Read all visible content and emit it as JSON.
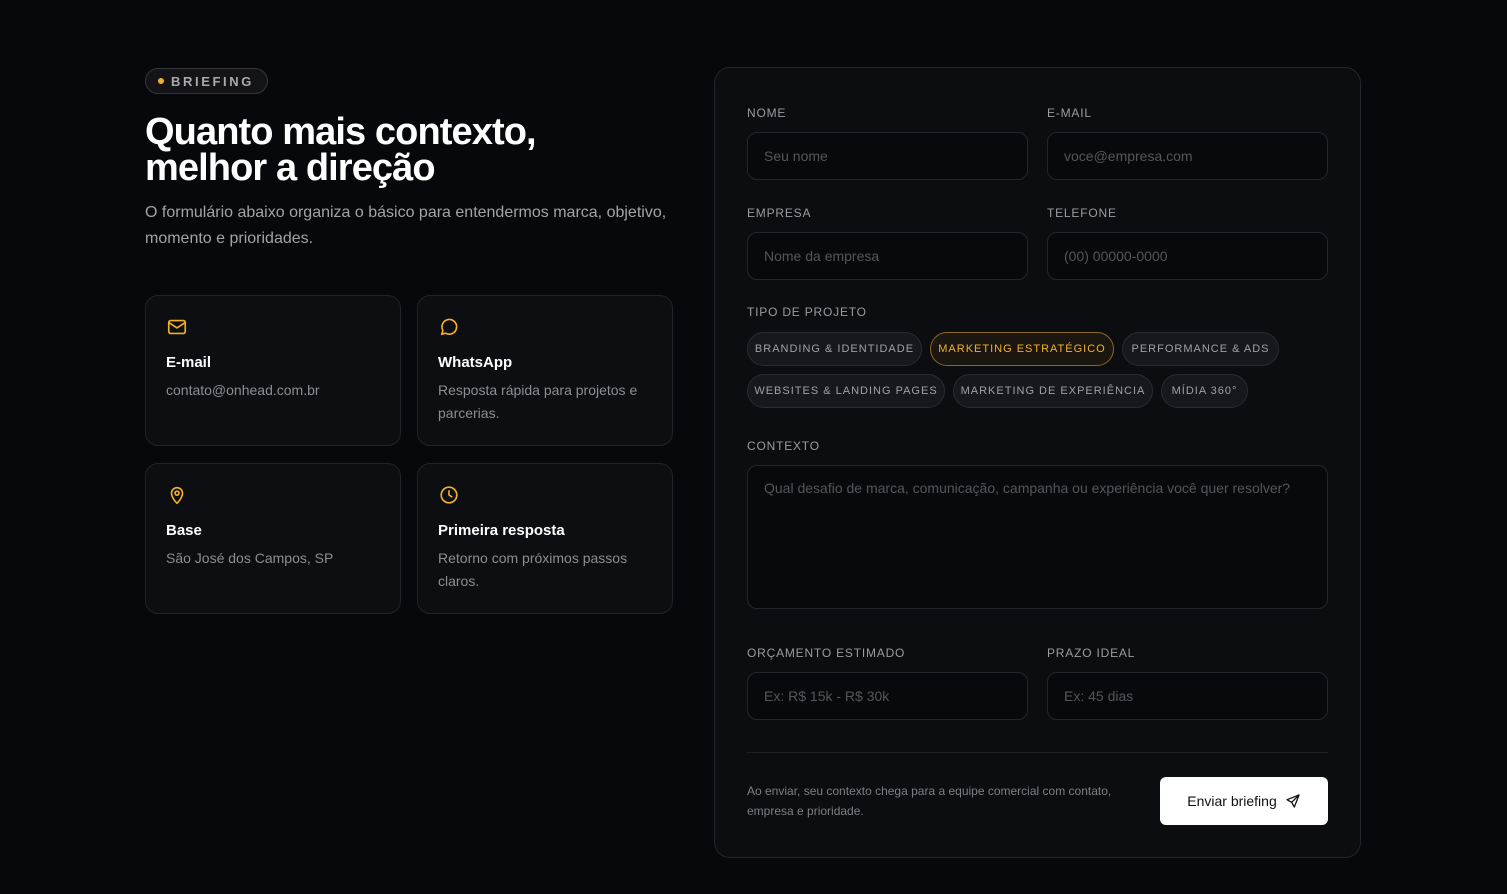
{
  "badge": {
    "label": "BRIEFING"
  },
  "hero": {
    "title_line1": "Quanto mais contexto,",
    "title_line2": "melhor a direção",
    "lead": "O formulário abaixo organiza o básico para entendermos marca, objetivo, momento e prioridades."
  },
  "cards": [
    {
      "icon": "mail-icon",
      "title": "E-mail",
      "text": "contato@onhead.com.br"
    },
    {
      "icon": "chat-icon",
      "title": "WhatsApp",
      "text": "Resposta rápida para projetos e parcerias."
    },
    {
      "icon": "map-pin-icon",
      "title": "Base",
      "text": "São José dos Campos, SP"
    },
    {
      "icon": "clock-icon",
      "title": "Primeira resposta",
      "text": "Retorno com próximos passos claros."
    }
  ],
  "form": {
    "name": {
      "label": "NOME",
      "placeholder": "Seu nome",
      "value": ""
    },
    "email": {
      "label": "E-MAIL",
      "placeholder": "voce@empresa.com",
      "value": ""
    },
    "company": {
      "label": "EMPRESA",
      "placeholder": "Nome da empresa",
      "value": ""
    },
    "phone": {
      "label": "TELEFONE",
      "placeholder": "(00) 00000-0000",
      "value": ""
    },
    "project_type": {
      "label": "TIPO DE PROJETO",
      "options": [
        {
          "label": "BRANDING & IDENTIDADE",
          "selected": false
        },
        {
          "label": "MARKETING ESTRATÉGICO",
          "selected": true
        },
        {
          "label": "PERFORMANCE & ADS",
          "selected": false
        },
        {
          "label": "WEBSITES & LANDING PAGES",
          "selected": false
        },
        {
          "label": "MARKETING DE EXPERIÊNCIA",
          "selected": false
        },
        {
          "label": "MÍDIA 360°",
          "selected": false
        }
      ]
    },
    "context": {
      "label": "CONTEXTO",
      "placeholder": "Qual desafio de marca, comunicação, campanha ou experiência você quer resolver?",
      "value": ""
    },
    "budget": {
      "label": "ORÇAMENTO ESTIMADO",
      "placeholder": "Ex: R$ 15k - R$ 30k",
      "value": ""
    },
    "deadline": {
      "label": "PRAZO IDEAL",
      "placeholder": "Ex: 45 dias",
      "value": ""
    },
    "note": "Ao enviar, seu contexto chega para a equipe comercial com contato, empresa e prioridade.",
    "submit_label": "Enviar briefing"
  },
  "colors": {
    "accent": "#f2b027",
    "background": "#07080b",
    "panel": "#0c0d11"
  }
}
